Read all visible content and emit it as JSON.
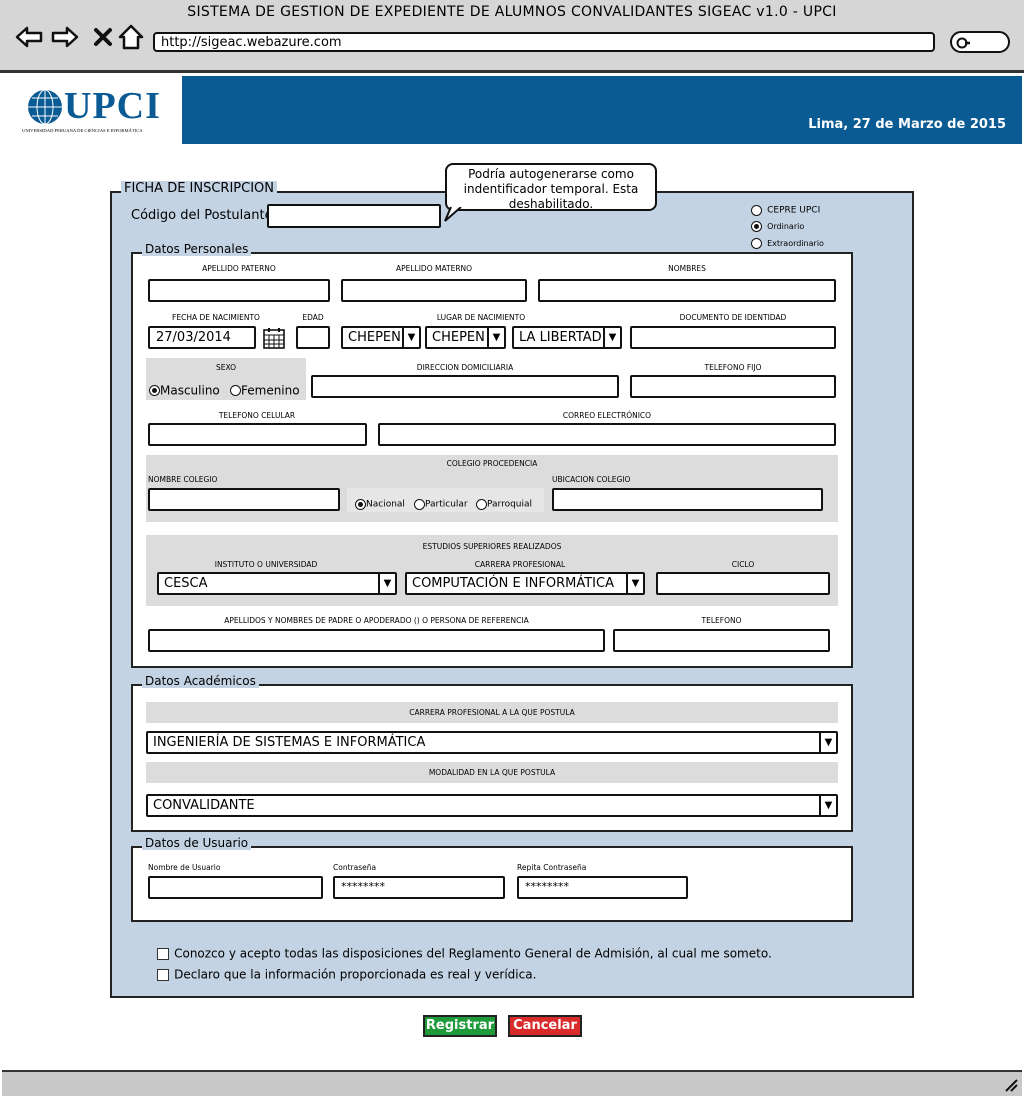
{
  "window": {
    "title": "SISTEMA DE GESTION DE EXPEDIENTE DE ALUMNOS CONVALIDANTES SIGEAC v1.0 - UPCI",
    "url": "http://sigeac.webazure.com"
  },
  "header": {
    "logo_text": "UPCI",
    "logo_subtext": "UNIVERSIDAD PERUANA DE CIENCIAS E INFORMÁTICA",
    "date": "Lima, 27 de Marzo de 2015"
  },
  "form": {
    "legend": "FICHA DE INSCRIPCION",
    "codigo_label": "Código del Postulante",
    "codigo_value": "",
    "tooltip": "Podría autogenerarse como indentificador temporal. Esta deshabilitado.",
    "modalidad_options": [
      {
        "label": "CEPRE UPCI",
        "selected": false
      },
      {
        "label": "Ordinario",
        "selected": true
      },
      {
        "label": "Extraordinario",
        "selected": false
      }
    ]
  },
  "personal": {
    "legend": "Datos Personales",
    "apellido_paterno": "APELLIDO PATERNO",
    "apellido_materno": "APELLIDO MATERNO",
    "nombres": "NOMBRES",
    "fecha_nacimiento": "FECHA DE NACIMIENTO",
    "fecha_value": "27/03/2014",
    "edad": "EDAD",
    "lugar_nacimiento": "LUGAR DE NACIMIENTO",
    "lugar_values": [
      "CHEPEN",
      "CHEPEN",
      "LA LIBERTAD"
    ],
    "documento": "DOCUMENTO DE IDENTIDAD",
    "sexo": "SEXO",
    "sexo_options": [
      {
        "label": "Masculino",
        "selected": true
      },
      {
        "label": "Femenino",
        "selected": false
      }
    ],
    "direccion": "DIRECCION DOMICILIARIA",
    "telefono_fijo": "TELEFONO FIJO",
    "telefono_celular": "TELEFONO CELULAR",
    "correo": "CORREO ELECTRÓNICO",
    "colegio_header": "COLEGIO PROCEDENCIA",
    "nombre_colegio": "NOMBRE COLEGIO",
    "colegio_tipo": [
      {
        "label": "Nacional",
        "selected": true
      },
      {
        "label": "Particular",
        "selected": false
      },
      {
        "label": "Parroquial",
        "selected": false
      }
    ],
    "ubicacion_colegio": "UBICACION COLEGIO",
    "estudios_header": "ESTUDIOS SUPERIORES REALIZADOS",
    "instituto": "INSTITUTO O UNIVERSIDAD",
    "instituto_value": "CESCA",
    "carrera": "CARRERA PROFESIONAL",
    "carrera_value": "COMPUTACIÓN E INFORMÁTICA",
    "ciclo": "CICLO",
    "padre": "APELLIDOS Y NOMBRES DE PADRE O APODERADO () O PERSONA DE REFERENCIA",
    "telefono": "TELEFONO"
  },
  "academic": {
    "legend": "Datos Académicos",
    "carrera_label": "CARRERA PROFESIONAL A LA QUE POSTULA",
    "carrera_value": "INGENIERÍA DE SISTEMAS E INFORMÁTICA",
    "modalidad_label": "MODALIDAD EN LA QUE POSTULA",
    "modalidad_value": "CONVALIDANTE"
  },
  "user": {
    "legend": "Datos de Usuario",
    "usuario_label": "Nombre de Usuario",
    "password_label": "Contraseña",
    "password_value": "********",
    "repeat_label": "Repita Contraseña",
    "repeat_value": "********"
  },
  "terms": {
    "accept": "Conozco y acepto todas las disposiciones del Reglamento General de Admisión, al cual me someto.",
    "declare": "Declaro que la información proporcionada es real y verídica."
  },
  "actions": {
    "register": "Registrar",
    "cancel": "Cancelar",
    "register_color": "#1e9a3a",
    "cancel_color": "#d92b2b"
  }
}
